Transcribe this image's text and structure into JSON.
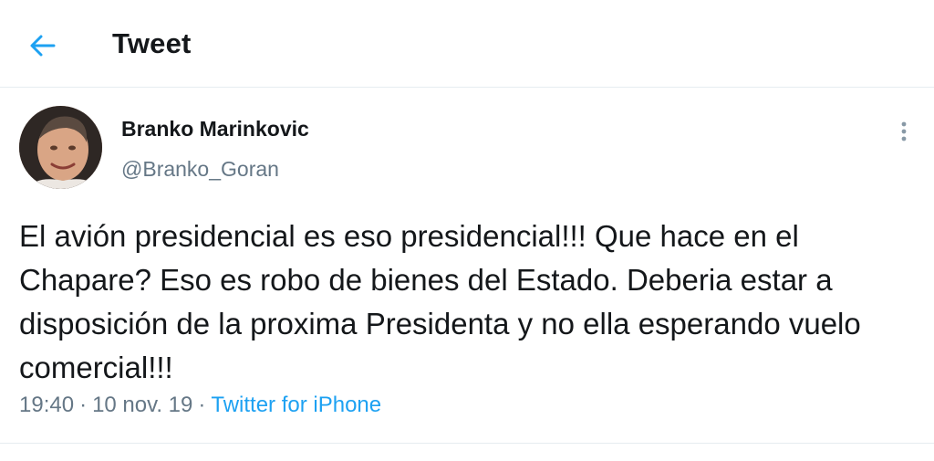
{
  "header": {
    "back_icon": "arrow-left-icon",
    "title": "Tweet"
  },
  "tweet": {
    "author": {
      "name": "Branko Marinkovic",
      "handle": "@Branko_Goran"
    },
    "more_icon": "more-vertical-icon",
    "text": "El avión presidencial es eso presidencial!!! Que hace en el Chapare? Eso es robo de bienes del Estado. Deberia estar a disposición de la proxima Presidenta y no ella esperando vuelo comercial!!!",
    "time": "19:40",
    "date": "10 nov. 19",
    "separator": "·",
    "source": "Twitter for iPhone"
  },
  "colors": {
    "accent": "#1da1f2",
    "text": "#14171a",
    "secondary": "#657786",
    "divider": "#e6ecf0"
  }
}
